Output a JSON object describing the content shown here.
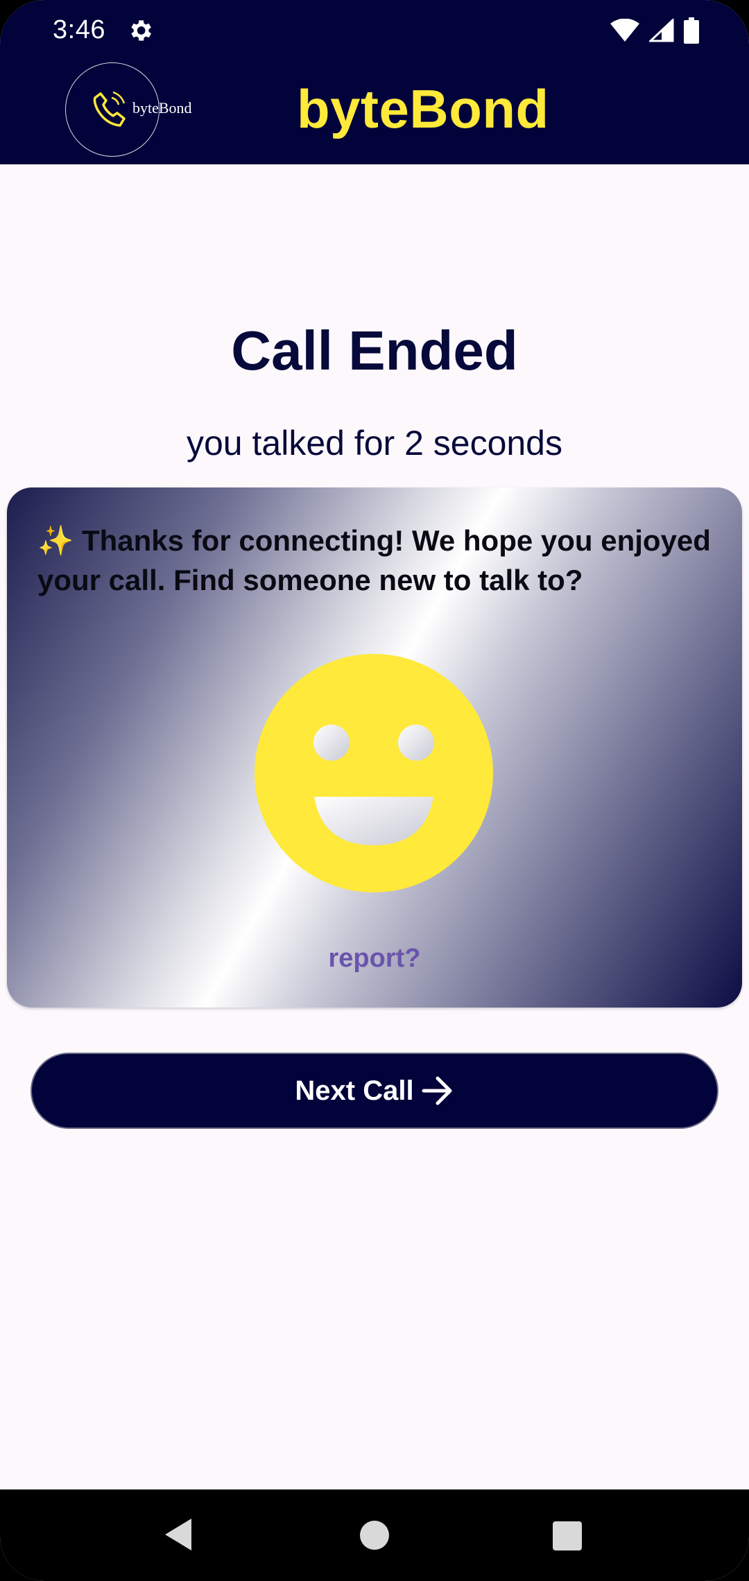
{
  "status_bar": {
    "time": "3:46",
    "icons": [
      "settings-icon",
      "wifi-icon",
      "signal-icon",
      "battery-icon"
    ]
  },
  "header": {
    "logo_text": "byteBond",
    "title": "byteBond"
  },
  "main": {
    "heading": "Call Ended",
    "subheading": "you talked for 2 seconds",
    "card": {
      "message": "✨ Thanks for connecting! We hope you enjoyed your call. Find someone new to talk to?",
      "report_label": "report?"
    },
    "next_button_label": "Next Call"
  },
  "colors": {
    "primary": "#02033a",
    "accent": "#ffe93a",
    "link": "#6a54ab",
    "background": "#fdf8fc"
  },
  "nav_bar": {
    "buttons": [
      "back-icon",
      "home-icon",
      "recents-icon"
    ]
  }
}
